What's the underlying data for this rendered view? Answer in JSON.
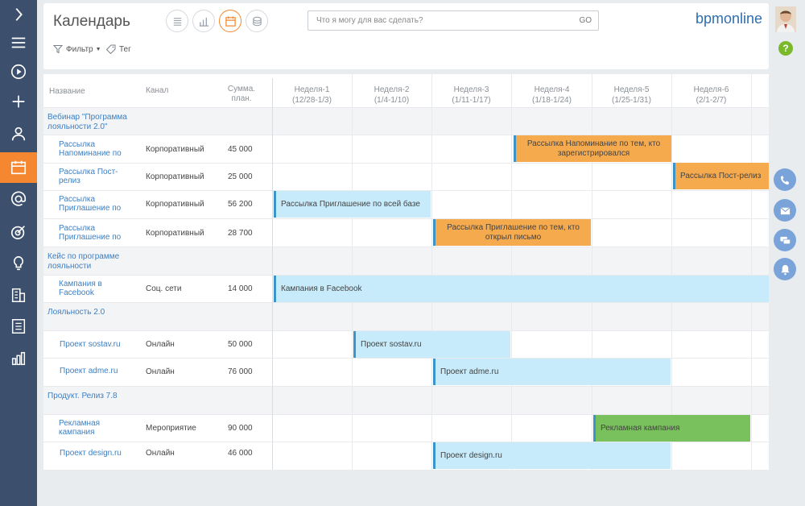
{
  "page": {
    "title": "Календарь",
    "logo": "bpmonline"
  },
  "search": {
    "placeholder": "Что я могу для вас сделать?",
    "go_label": "GO"
  },
  "toolbar": {
    "filter_label": "Фильтр",
    "tag_label": "Тег",
    "view_buttons": [
      "list-view-icon",
      "chart-view-icon",
      "calendar-view-icon",
      "archive-view-icon"
    ],
    "active_view": "calendar-view-icon"
  },
  "sidebar": {
    "items": [
      "chevron-right-icon",
      "menu-icon",
      "play-icon",
      "plus-icon",
      "user-icon",
      "calendar-icon",
      "at-icon",
      "target-icon",
      "lightbulb-icon",
      "building-icon",
      "document-icon",
      "bar-chart-icon"
    ],
    "active": "calendar-icon"
  },
  "right_panel": {
    "help_label": "?",
    "actions": [
      "phone-icon",
      "mail-icon",
      "chat-icon",
      "bell-icon"
    ]
  },
  "colors": {
    "sidebar": "#3c4f6d",
    "accent": "#f4872f",
    "link": "#3d7fc1",
    "bar_blue": "#c7ebfa",
    "bar_orange": "#f6aa4e",
    "bar_green": "#79c15c"
  },
  "table": {
    "columns": {
      "name": "Название",
      "channel": "Канал",
      "sum": "Сумма. план."
    },
    "weeks": [
      {
        "label": "Неделя-1",
        "range": "(12/28-1/3)"
      },
      {
        "label": "Неделя-2",
        "range": "(1/4-1/10)"
      },
      {
        "label": "Неделя-3",
        "range": "(1/11-1/17)"
      },
      {
        "label": "Неделя-4",
        "range": "(1/18-1/24)"
      },
      {
        "label": "Неделя-5",
        "range": "(1/25-1/31)"
      },
      {
        "label": "Неделя-6",
        "range": "(2/1-2/7)"
      }
    ],
    "groups": [
      {
        "title": "Вебинар \"Программа лояльности 2.0\"",
        "rows": [
          {
            "name": "Рассылка Напоминание по",
            "channel": "Корпоративный",
            "sum": "45 000",
            "bar": {
              "label": "Рассылка Напоминание по тем, кто зарегистрировался",
              "color": "orange"
            }
          },
          {
            "name": "Рассылка Пост-релиз",
            "channel": "Корпоративный",
            "sum": "25 000",
            "bar": {
              "label": "Рассылка Пост-релиз",
              "color": "orange"
            }
          },
          {
            "name": "Рассылка Приглашение по",
            "channel": "Корпоративный",
            "sum": "56 200",
            "bar": {
              "label": "Рассылка Приглашение по всей базе",
              "color": "blue"
            }
          },
          {
            "name": "Рассылка Приглашение по",
            "channel": "Корпоративный",
            "sum": "28 700",
            "bar": {
              "label": "Рассылка Приглашение по тем, кто открыл письмо",
              "color": "orange"
            }
          }
        ]
      },
      {
        "title": "Кейс по программе лояльности",
        "rows": [
          {
            "name": "Кампания в Facebook",
            "channel": "Соц. сети",
            "sum": "14 000",
            "bar": {
              "label": "Кампания в Facebook",
              "color": "blue"
            }
          }
        ]
      },
      {
        "title": "Лояльность 2.0",
        "rows": [
          {
            "name": "Проект sostav.ru",
            "channel": "Онлайн",
            "sum": "50 000",
            "bar": {
              "label": "Проект sostav.ru",
              "color": "blue"
            }
          },
          {
            "name": "Проект adme.ru",
            "channel": "Онлайн",
            "sum": "76 000",
            "bar": {
              "label": "Проект adme.ru",
              "color": "blue"
            }
          }
        ]
      },
      {
        "title": "Продукт. Релиз 7.8",
        "rows": [
          {
            "name": "Рекламная кампания",
            "channel": "Мероприятие",
            "sum": "90 000",
            "bar": {
              "label": "Рекламная кампания",
              "color": "green"
            }
          },
          {
            "name": "Проект design.ru",
            "channel": "Онлайн",
            "sum": "46 000",
            "bar": {
              "label": "Проект design.ru",
              "color": "blue"
            }
          }
        ]
      }
    ]
  }
}
